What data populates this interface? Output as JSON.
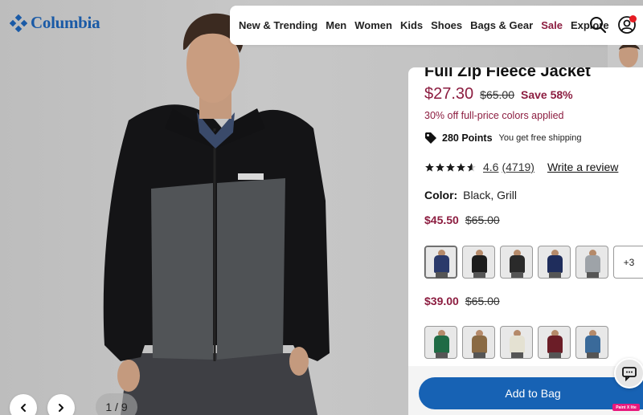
{
  "brand": {
    "name": "Columbia",
    "color": "#1a5aa6"
  },
  "nav": {
    "items": [
      "New & Trending",
      "Men",
      "Women",
      "Kids",
      "Shoes",
      "Bags & Gear",
      "Sale",
      "Explore"
    ],
    "search_icon": "search-icon",
    "account_icon": "account-icon"
  },
  "product": {
    "title": "Full Zip Fleece Jacket",
    "price": "$27.30",
    "original_price": "$65.00",
    "save": "Save 58%",
    "promo": "30% off full-price colors applied",
    "points": "280 Points",
    "shipping": "You get free shipping",
    "rating": "4.6",
    "rating_fraction": 0.92,
    "review_count": "(4719)",
    "write_review": "Write a review",
    "color_label": "Color:",
    "color_value": "Black, Grill"
  },
  "price_groups": [
    {
      "sale": "$45.50",
      "original": "$65.00",
      "swatches": [
        {
          "name": "navy-grey",
          "color": "#2b3a6b"
        },
        {
          "name": "black",
          "color": "#1c1c1c"
        },
        {
          "name": "black-grill",
          "color": "#2a2a2a"
        },
        {
          "name": "navy",
          "color": "#1f2d5c"
        },
        {
          "name": "light-grey",
          "color": "#9ea3a8"
        }
      ],
      "more_label": "+3"
    },
    {
      "sale": "$39.00",
      "original": "$65.00",
      "swatches": [
        {
          "name": "green",
          "color": "#1f6b45"
        },
        {
          "name": "black-tan",
          "color": "#8a6a44"
        },
        {
          "name": "cream",
          "color": "#e4e1d2"
        },
        {
          "name": "burgundy",
          "color": "#6b1d27"
        },
        {
          "name": "blue",
          "color": "#3a6a9a"
        }
      ]
    }
  ],
  "cta": {
    "add_to_bag": "Add to Bag"
  },
  "carousel": {
    "counter": "1 / 9"
  },
  "overlay": {
    "paint_label": "Paint X lite"
  },
  "colors": {
    "sale": "#8c1d40",
    "primary": "#1762b4"
  }
}
